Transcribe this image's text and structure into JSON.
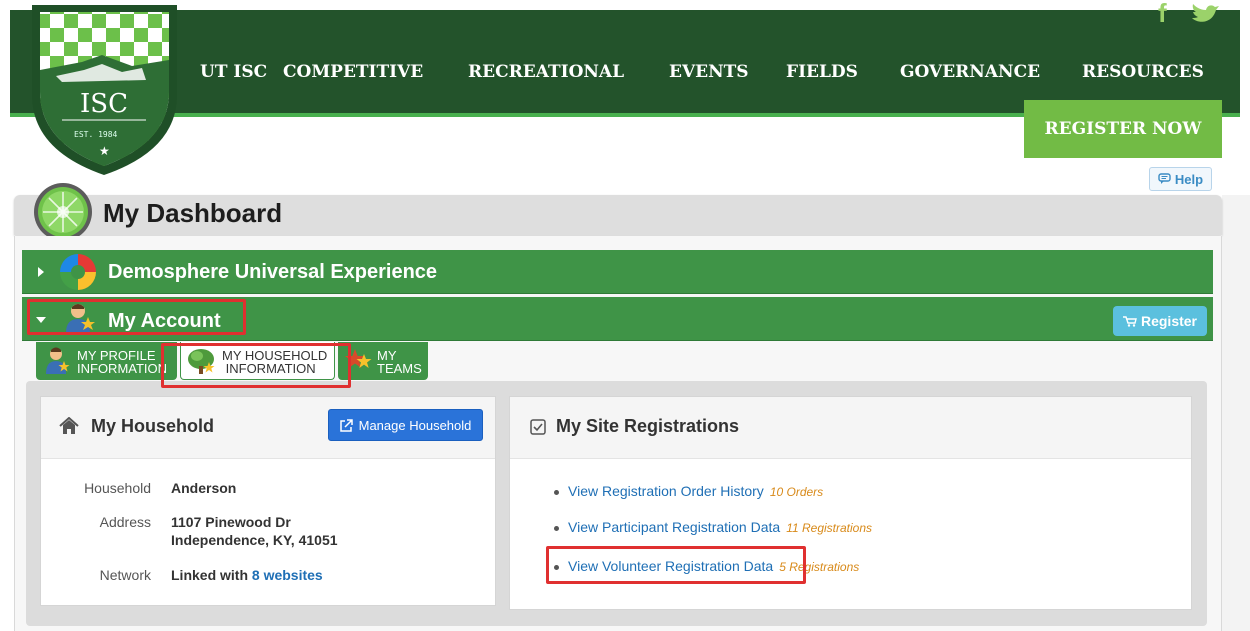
{
  "header": {
    "nav": [
      "UT ISC",
      "COMPETITIVE",
      "RECREATIONAL",
      "EVENTS",
      "FIELDS",
      "GOVERNANCE",
      "RESOURCES"
    ],
    "social": {
      "facebook": "f",
      "twitter": "twitter-icon"
    },
    "logo": {
      "abbr": "ISC",
      "est": "EST. 1984"
    },
    "register_now": "REGISTER NOW"
  },
  "help": {
    "label": "Help"
  },
  "dashboard": {
    "title": "My Dashboard"
  },
  "sections": {
    "demosphere": "Demosphere Universal Experience",
    "my_account": "My Account",
    "register": "Register"
  },
  "tabs": [
    {
      "line1": "MY PROFILE",
      "line2": "INFORMATION"
    },
    {
      "line1": "MY HOUSEHOLD",
      "line2": "INFORMATION"
    },
    {
      "line1": "MY",
      "line2": "TEAMS"
    }
  ],
  "household": {
    "title": "My Household",
    "manage_label": "Manage Household",
    "labels": {
      "household": "Household",
      "address": "Address",
      "network": "Network"
    },
    "name": "Anderson",
    "address_line1": "1107 Pinewood Dr",
    "address_line2": "Independence, KY, 41051",
    "network_prefix": "Linked with",
    "network_link": "8 websites"
  },
  "registrations": {
    "title": "My Site Registrations",
    "items": [
      {
        "label": "View Registration Order History",
        "count": "10 Orders"
      },
      {
        "label": "View Participant Registration Data",
        "count": "11 Registrations"
      },
      {
        "label": "View Volunteer Registration Data",
        "count": "5 Registrations"
      }
    ]
  },
  "colors": {
    "header_green": "#23532b",
    "bar_green": "#3f9447",
    "register_green": "#72bb45",
    "link_blue": "#1f6fb5",
    "count_orange": "#d88a1a",
    "highlight_red": "#e03030"
  }
}
